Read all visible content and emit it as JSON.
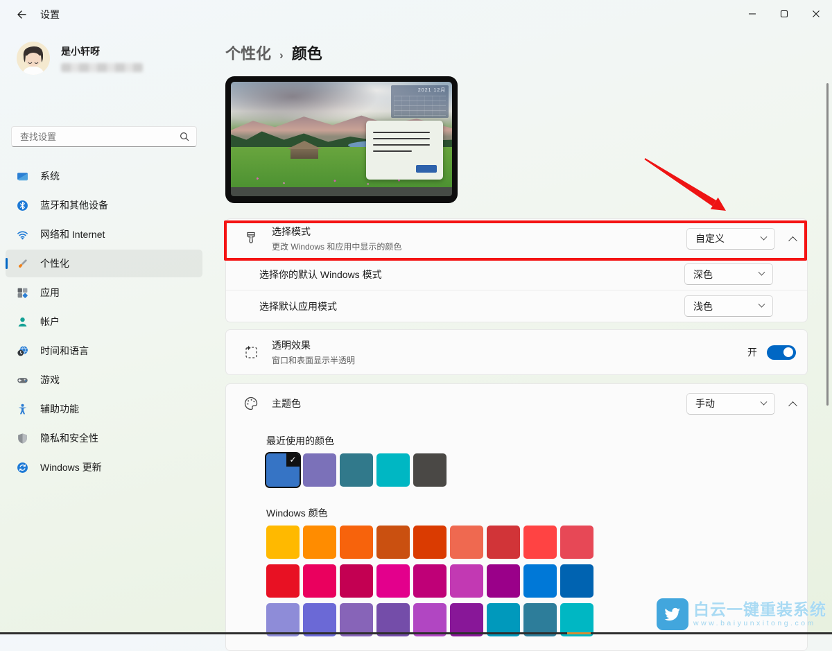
{
  "colors": {
    "accent": "#0067c4",
    "annotation_red": "#f41414",
    "scrollbar": "#8a8a8a"
  },
  "titlebar": {
    "title": "设置"
  },
  "profile": {
    "name": "是小轩呀"
  },
  "search": {
    "placeholder": "查找设置"
  },
  "sidebar": {
    "items": [
      {
        "id": "system",
        "label": "系统",
        "selected": false
      },
      {
        "id": "bluetooth",
        "label": "蓝牙和其他设备",
        "selected": false
      },
      {
        "id": "network",
        "label": "网络和 Internet",
        "selected": false
      },
      {
        "id": "personalization",
        "label": "个性化",
        "selected": true
      },
      {
        "id": "apps",
        "label": "应用",
        "selected": false
      },
      {
        "id": "accounts",
        "label": "帐户",
        "selected": false
      },
      {
        "id": "time-language",
        "label": "时间和语言",
        "selected": false
      },
      {
        "id": "gaming",
        "label": "游戏",
        "selected": false
      },
      {
        "id": "accessibility",
        "label": "辅助功能",
        "selected": false
      },
      {
        "id": "privacy",
        "label": "隐私和安全性",
        "selected": false
      },
      {
        "id": "windows-update",
        "label": "Windows 更新",
        "selected": false
      }
    ]
  },
  "breadcrumb": {
    "parent": "个性化",
    "separator": "›",
    "current": "颜色"
  },
  "preview": {
    "calendar_title": "2021 12月"
  },
  "settings": {
    "mode": {
      "title": "选择模式",
      "subtitle": "更改 Windows 和应用中显示的颜色",
      "value": "自定义"
    },
    "windows_mode": {
      "label": "选择你的默认 Windows 模式",
      "value": "深色"
    },
    "app_mode": {
      "label": "选择默认应用模式",
      "value": "浅色"
    },
    "transparency": {
      "title": "透明效果",
      "subtitle": "窗口和表面显示半透明",
      "state_label": "开",
      "enabled": true
    },
    "theme_color": {
      "title": "主题色",
      "value": "手动"
    }
  },
  "recent_colors": {
    "label": "最近使用的颜色",
    "selected_index": 0,
    "swatches": [
      "#3674c5",
      "#7b71b9",
      "#31798b",
      "#00b7c3",
      "#4a4845"
    ]
  },
  "windows_colors": {
    "label": "Windows 颜色",
    "rows": [
      [
        "#ffb900",
        "#ff8c00",
        "#f7630c",
        "#ca5010",
        "#da3b01",
        "#ef6950",
        "#d13438",
        "#ff4343",
        "#e74856"
      ],
      [
        "#e81123",
        "#ea005e",
        "#c30052",
        "#e3008c",
        "#bf0077",
        "#c239b3",
        "#9a0089",
        "#0078d7",
        "#0063b1"
      ],
      [
        "#8e8cd8",
        "#6b69d6",
        "#8764b8",
        "#744da9",
        "#b146c2",
        "#881798",
        "#0099bc",
        "#2d7d9a",
        "#00b7c3"
      ]
    ]
  },
  "watermark": {
    "brand": "白云一键重装系统",
    "url": "www.baiyunxitong.com"
  }
}
